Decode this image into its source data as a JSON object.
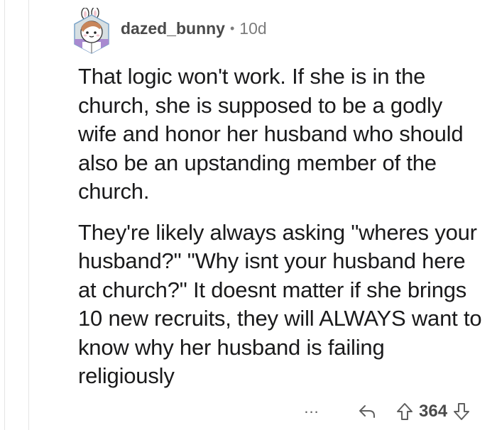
{
  "comment": {
    "username": "dazed_bunny",
    "separator": "•",
    "age": "10d",
    "paragraphs": [
      "That logic won't work. If she is in the church, she is supposed to be a godly wife and honor her husband who should also be an upstanding member of the church.",
      "They're likely always asking \"wheres your husband?\" \"Why isnt your husband here at church?\" It doesnt matter if she brings 10 new recruits, they will ALWAYS want to know why her husband is failing religiously"
    ],
    "actions": {
      "more": "...",
      "score": "364"
    }
  },
  "icons": {
    "avatar": "bunny-avatar-icon",
    "reply": "reply-arrow-icon",
    "upvote": "upvote-arrow-icon",
    "downvote": "downvote-arrow-icon"
  },
  "colors": {
    "text": "#1a1a1b",
    "meta": "#7c7c7c",
    "thread_line": "#e5e5e5",
    "avatar_bg": "#d7dfe2"
  }
}
